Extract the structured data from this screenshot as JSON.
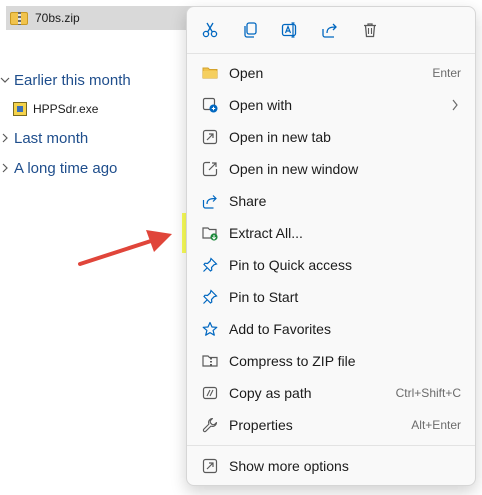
{
  "explorer": {
    "selected_file": "70bs.zip",
    "groups": [
      {
        "label": "Earlier this month",
        "expanded": true
      },
      {
        "label": "Last month",
        "expanded": false
      },
      {
        "label": "A long time ago",
        "expanded": false
      }
    ],
    "earlier_file": "HPPSdr.exe"
  },
  "context_menu": {
    "toolbar_icons": [
      "cut-icon",
      "copy-icon",
      "rename-icon",
      "share-icon",
      "delete-icon"
    ],
    "items": [
      {
        "label": "Open",
        "shortcut": "Enter",
        "icon": "folder-icon"
      },
      {
        "label": "Open with",
        "shortcut": "",
        "icon": "open-with-icon",
        "submenu": "›"
      },
      {
        "label": "Open in new tab",
        "shortcut": "",
        "icon": "new-tab-icon"
      },
      {
        "label": "Open in new window",
        "shortcut": "",
        "icon": "new-window-icon"
      },
      {
        "label": "Share",
        "shortcut": "",
        "icon": "share-icon"
      },
      {
        "label": "Extract All...",
        "shortcut": "",
        "icon": "extract-icon",
        "highlighted": true
      },
      {
        "label": "Pin to Quick access",
        "shortcut": "",
        "icon": "pin-icon"
      },
      {
        "label": "Pin to Start",
        "shortcut": "",
        "icon": "pin-icon"
      },
      {
        "label": "Add to Favorites",
        "shortcut": "",
        "icon": "star-icon"
      },
      {
        "label": "Compress to ZIP file",
        "shortcut": "",
        "icon": "zip-folder-icon"
      },
      {
        "label": "Copy as path",
        "shortcut": "Ctrl+Shift+C",
        "icon": "copy-path-icon"
      },
      {
        "label": "Properties",
        "shortcut": "Alt+Enter",
        "icon": "wrench-icon"
      }
    ],
    "more_options": {
      "label": "Show more options",
      "icon": "more-options-icon"
    }
  },
  "colors": {
    "highlight": "#fbff4a",
    "arrow": "#e0453a",
    "accent": "#0067c0",
    "group_label": "#1f4e8c"
  }
}
